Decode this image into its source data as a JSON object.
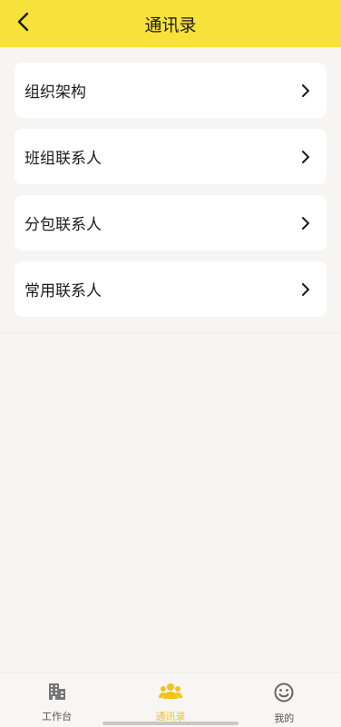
{
  "header": {
    "title": "通讯录",
    "back_icon": "chevron-left-icon",
    "background": "#f7e23b"
  },
  "menu": {
    "items": [
      {
        "label": "组织架构",
        "icon": "chevron-right-icon"
      },
      {
        "label": "班组联系人",
        "icon": "chevron-right-icon"
      },
      {
        "label": "分包联系人",
        "icon": "chevron-right-icon"
      },
      {
        "label": "常用联系人",
        "icon": "chevron-right-icon"
      }
    ]
  },
  "tabbar": {
    "active_color": "#f0c419",
    "tabs": [
      {
        "label": "工作台",
        "icon": "building-icon",
        "active": false
      },
      {
        "label": "通讯录",
        "icon": "contacts-icon",
        "active": true
      },
      {
        "label": "我的",
        "icon": "smiley-icon",
        "active": false
      }
    ]
  }
}
